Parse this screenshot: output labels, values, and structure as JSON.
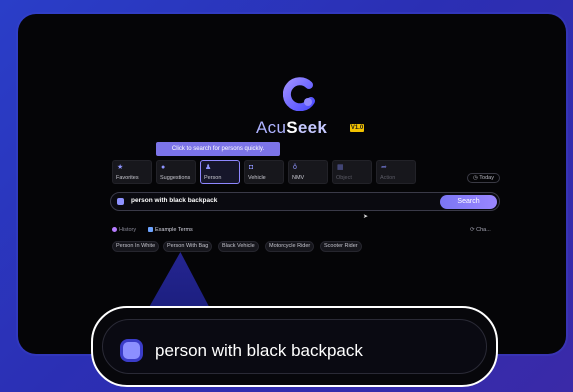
{
  "app": {
    "name_part1": "Acu",
    "name_part2": "S",
    "name_part3": "eek",
    "version": "V1.0"
  },
  "tooltip": "Click to search for persons quickly.",
  "categories": [
    {
      "label": "Favorites",
      "icon": "star-icon"
    },
    {
      "label": "Suggestions",
      "icon": "lightbulb-icon"
    },
    {
      "label": "Person",
      "icon": "person-icon"
    },
    {
      "label": "Vehicle",
      "icon": "car-icon"
    },
    {
      "label": "NMV",
      "icon": "bike-icon"
    },
    {
      "label": "Object",
      "icon": "box-icon"
    },
    {
      "label": "Action",
      "icon": "action-icon"
    }
  ],
  "today_label": "Today",
  "search": {
    "value": "person with black backpack",
    "button": "Search"
  },
  "history_label": "History",
  "examples_label": "Example Terms",
  "change_label": "Cha...",
  "chips": [
    "Person In White",
    "Person With Bag",
    "Black Vehicle",
    "Motorcycle Rider",
    "Scooter Rider"
  ],
  "zoom_text": "person with black backpack",
  "colors": {
    "accent": "#8e87ff",
    "brand": "#2b35c4",
    "version_badge": "#f2c200"
  }
}
